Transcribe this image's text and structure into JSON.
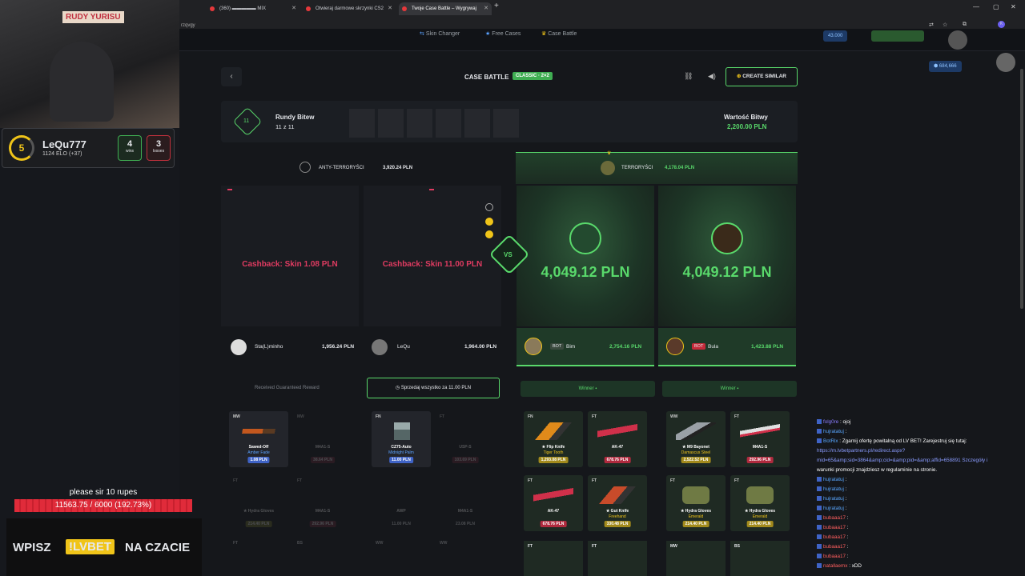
{
  "browser": {
    "tabs": [
      {
        "label": "(360) ▬▬▬▬▬ MIX",
        "active": false
      },
      {
        "label": "Otwieraj darmowe skrzynki CS2",
        "active": false
      },
      {
        "label": "Twoje Case Battle – Wygrywaj",
        "active": true
      }
    ],
    "new_tab": "+",
    "url": "rzqvgy"
  },
  "site_nav": {
    "items": [
      "Skin Changer",
      "Free Cases",
      "Case Battle"
    ],
    "balance1": "43.000",
    "balance2": "684,666",
    "level": "92"
  },
  "battle": {
    "title": "CASE BATTLE",
    "mode_badge": "CLASSIC · 2×2",
    "create_similar": "CREATE SIMILAR",
    "rounds_label": "Rundy Bitew",
    "rounds_value": "11 z 11",
    "rounds_badge": "11",
    "value_label": "Wartość Bitwy",
    "value_amount": "2,200.00 PLN",
    "vs": "VS"
  },
  "teams": {
    "ct": {
      "name": "ANTY-TERRORYŚCI",
      "total": "3,920.24 PLN"
    },
    "t": {
      "name": "TERRORYŚCI",
      "total": "4,178.04 PLN"
    }
  },
  "slots": [
    {
      "text": "Cashback: Skin 1.08 PLN",
      "player": "Sta(L)minho",
      "amount": "1,956.24 PLN",
      "bot": ""
    },
    {
      "text": "Cashback: Skin 11.00 PLN",
      "player": "LeQu",
      "amount": "1,964.00 PLN",
      "bot": ""
    },
    {
      "text": "4,049.12 PLN",
      "player": "Bim",
      "amount": "2,754.16 PLN",
      "bot": "BOT"
    },
    {
      "text": "4,049.12 PLN",
      "player": "Bula",
      "amount": "1,423.88 PLN",
      "bot": "BOT"
    }
  ],
  "rewards": {
    "guaranteed": "Received Guaranteed Reward",
    "sell_all": "Sprzedaj wszystko za 11.00 PLN",
    "winner1": "Winner",
    "winner2": "Winner"
  },
  "items": {
    "col1": [
      {
        "cond": "MW",
        "name": "Sawed-Off",
        "skin": "Amber Fade",
        "price": "1.08 PLN"
      },
      {
        "cond": "MW",
        "name": "M4A1-S",
        "skin": "",
        "price": "38.64 PLN"
      },
      {
        "cond": "FT",
        "name": "★ Hydra Gloves",
        "skin": "Emerald",
        "price": "214.40 PLN"
      },
      {
        "cond": "FT",
        "name": "M4A1-S",
        "skin": "",
        "price": "292.96 PLN"
      }
    ],
    "col2": [
      {
        "cond": "FN",
        "name": "CZ75-Auto",
        "skin": "Midnight Palm",
        "price": "11.00 PLN"
      },
      {
        "cond": "FT",
        "name": "USP-S",
        "skin": "",
        "price": "103.69 PLN"
      },
      {
        "cond": "",
        "name": "AWP",
        "skin": "",
        "price": "11.00 PLN"
      },
      {
        "cond": "",
        "name": "M4A1-S",
        "skin": "",
        "price": "23.08 PLN"
      }
    ],
    "col3": [
      {
        "cond": "FN",
        "name": "★ Flip Knife",
        "skin": "Tiger Tooth",
        "price": "1,293.08 PLN"
      },
      {
        "cond": "FT",
        "name": "AK-47",
        "skin": "",
        "price": "678.76 PLN"
      },
      {
        "cond": "FT",
        "name": "AK-47",
        "skin": "",
        "price": "678.76 PLN"
      },
      {
        "cond": "FT",
        "name": "★ Gut Knife",
        "skin": "Freehand",
        "price": "330.48 PLN"
      }
    ],
    "col4": [
      {
        "cond": "WW",
        "name": "★ M9 Bayonet",
        "skin": "Damascus Steel",
        "price": "2,522.52 PLN"
      },
      {
        "cond": "FT",
        "name": "M4A1-S",
        "skin": "",
        "price": "292.96 PLN"
      },
      {
        "cond": "FT",
        "name": "★ Hydra Gloves",
        "skin": "Emerald",
        "price": "214.40 PLN"
      },
      {
        "cond": "FT",
        "name": "★ Hydra Gloves",
        "skin": "Emerald",
        "price": "214.40 PLN"
      }
    ],
    "row3_conds": [
      "FT",
      "FT",
      "MW",
      "BS",
      "WW",
      "WW"
    ]
  },
  "stream": {
    "webcam_sign": "RUDY YURISU",
    "player_name": "LeQu777",
    "player_level": "5",
    "elo": "1124 ELO (+37)",
    "wins": "4",
    "wins_label": "wins",
    "losses": "3",
    "losses_label": "losses",
    "goal_title": "please sir 10 rupes",
    "goal_value": "11563.75 / 6000 (192.73%)",
    "goal_progress": 1.0,
    "promo_left": "WPISZ",
    "promo_code": "!LVBET",
    "promo_right": "NA CZACIE"
  },
  "chat": [
    {
      "user": "folg0re",
      "color": "#8a7cff",
      "text": ": ojoj"
    },
    {
      "user": "hujratatuj",
      "color": "#59a7ff",
      "text": ":"
    },
    {
      "user": "BotRix",
      "color": "#59a7ff",
      "text": ": Zgarnij ofertę powitalną od LV BET! Zarejestruj się tutaj:"
    },
    {
      "user": "",
      "color": "#8a9cff",
      "text": "https://m.lvbetpartners.pl/redirect.aspx?"
    },
    {
      "user": "",
      "color": "#8a9cff",
      "text": "mid=65&amp;sid=3864&amp;cid=&amp;pid=&amp;affid=658891 Szczegóły i"
    },
    {
      "user": "",
      "color": "#fff",
      "text": "warunki promocji znajdziesz w regulaminie na stronie."
    },
    {
      "user": "hujratatuj",
      "color": "#59a7ff",
      "text": ":"
    },
    {
      "user": "hujratatuj",
      "color": "#59a7ff",
      "text": ":"
    },
    {
      "user": "hujratatuj",
      "color": "#59a7ff",
      "text": ":"
    },
    {
      "user": "hujratatuj",
      "color": "#59a7ff",
      "text": ":"
    },
    {
      "user": "bubaaa17",
      "color": "#ff5f5f",
      "text": ":"
    },
    {
      "user": "bubaaa17",
      "color": "#ff5f5f",
      "text": ":"
    },
    {
      "user": "bubaaa17",
      "color": "#ff5f5f",
      "text": ":"
    },
    {
      "user": "bubaaa17",
      "color": "#ff5f5f",
      "text": ":"
    },
    {
      "user": "bubaaa17",
      "color": "#ff5f5f",
      "text": ":"
    },
    {
      "user": "natallaemx",
      "color": "#ff5f5f",
      "text": ": xDD"
    }
  ],
  "colors": {
    "accent_green": "#59d96b",
    "cashback_pink": "#e03b61",
    "goal_red": "#e02b3a",
    "promo_yellow": "#f0c419"
  }
}
